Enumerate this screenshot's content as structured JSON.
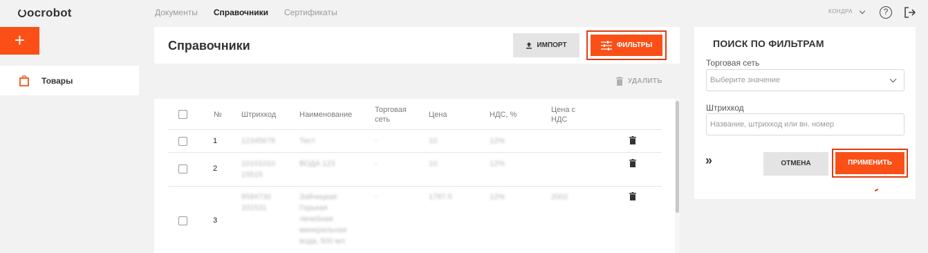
{
  "app": {
    "logo_text": "ocrobot"
  },
  "topnav": {
    "items": [
      {
        "label": "Документы",
        "active": false
      },
      {
        "label": "Справочники",
        "active": true
      },
      {
        "label": "Сертификаты",
        "active": false
      }
    ],
    "user_label": "КОНДРА"
  },
  "sidebar": {
    "add_label": "+",
    "items": [
      {
        "label": "Товары",
        "icon": "bag-icon",
        "active": true
      }
    ]
  },
  "header": {
    "title": "Справочники",
    "import_label": "ИМПОРТ",
    "filters_label": "ФИЛЬТРЫ"
  },
  "toolbar": {
    "delete_label": "УДАЛИТЬ"
  },
  "table": {
    "columns": [
      "№",
      "Штрихкод",
      "Наименование",
      "Торговая сеть",
      "Цена",
      "НДС, %",
      "Цена с НДС"
    ],
    "rows": [
      {
        "num": "1",
        "barcode": "12345678",
        "name": "Тест",
        "network": "-",
        "price": "10",
        "vat": "12%",
        "price_vat": ""
      },
      {
        "num": "2",
        "barcode": "10101010 15515",
        "name": "ВОДА 123",
        "network": "-",
        "price": "10",
        "vat": "12%",
        "price_vat": ""
      },
      {
        "num": "3",
        "barcode": "8584730 331531",
        "name": "Зайчицкая Горькая лечебная минеральная вода, 500 мл",
        "network": "-",
        "price": "1787.5",
        "vat": "12%",
        "price_vat": "2002"
      }
    ]
  },
  "filter_panel": {
    "title": "ПОИСК ПО ФИЛЬТРАМ",
    "network_label": "Торговая сеть",
    "network_placeholder": "Выберите значение",
    "barcode_label": "Штрихкод",
    "barcode_placeholder": "Название, штрихкод или вн. номер",
    "collapse_label": "»",
    "cancel_label": "ОТМЕНА",
    "apply_label": "ПРИМЕНИТЬ"
  },
  "colors": {
    "accent": "#fa5017",
    "highlight": "#e03c10",
    "background": "#f2f2f2"
  }
}
